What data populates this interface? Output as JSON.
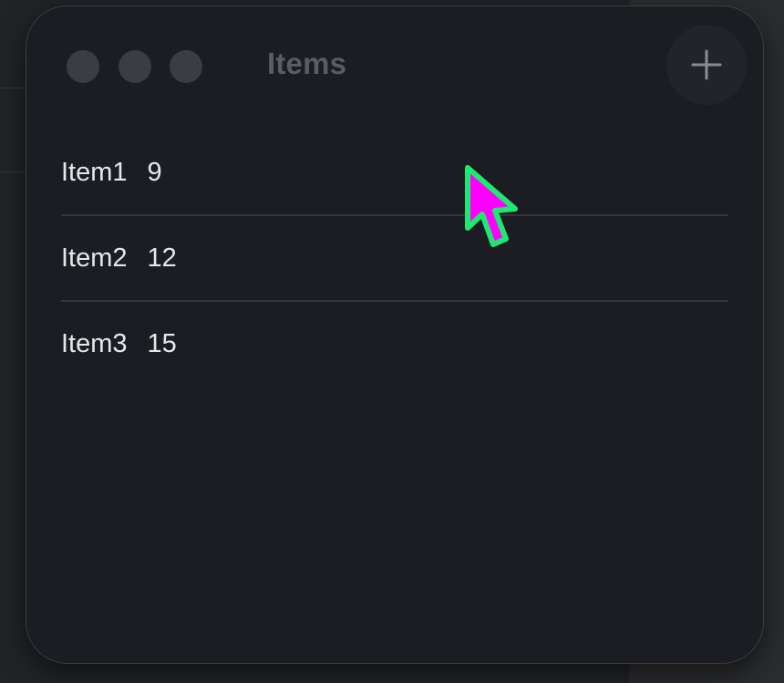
{
  "window": {
    "title": "Items"
  },
  "toolbar": {
    "add_label": "+"
  },
  "items": [
    {
      "name": "Item1",
      "count": "9"
    },
    {
      "name": "Item2",
      "count": "12"
    },
    {
      "name": "Item3",
      "count": "15"
    }
  ],
  "colors": {
    "window_bg": "#1b1d22",
    "text": "#e6e7ea",
    "title": "#5a5c62",
    "cursor_fill": "#ff00ff",
    "cursor_outline": "#1ee870"
  },
  "icons": [
    "close-icon",
    "minimize-icon",
    "zoom-icon",
    "plus-icon",
    "pointer-cursor-icon"
  ]
}
